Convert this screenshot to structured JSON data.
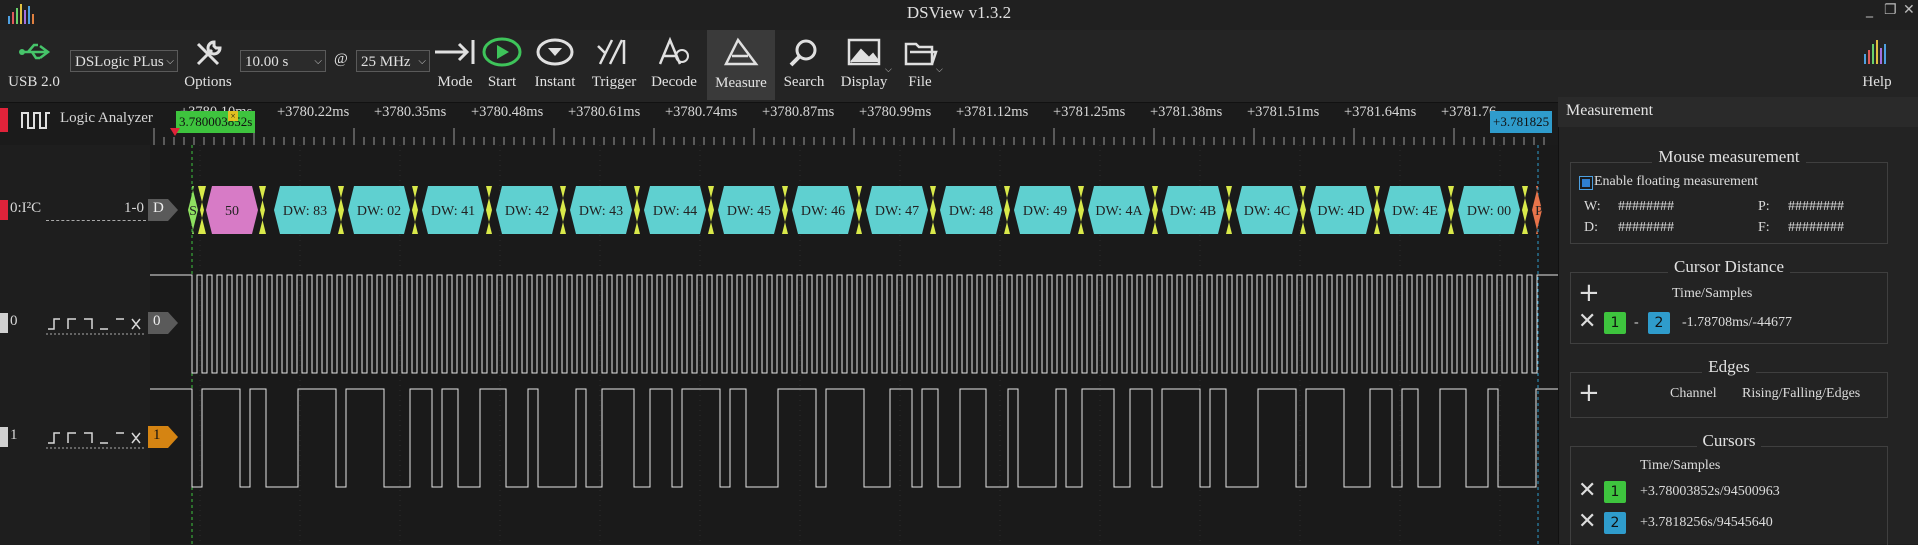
{
  "window": {
    "title": "DSView v1.3.2"
  },
  "toolbar": {
    "usb_label": "USB 2.0",
    "device": "DSLogic PLus",
    "options_label": "Options",
    "duration": "10.00 s",
    "at": "@",
    "rate": "25 MHz",
    "buttons": [
      "Mode",
      "Start",
      "Instant",
      "Trigger",
      "Decode",
      "Measure",
      "Search",
      "Display",
      "File"
    ],
    "help_label": "Help"
  },
  "ruler": {
    "ticks": [
      "+3780.10ms",
      "+3780.22ms",
      "+3780.35ms",
      "+3780.48ms",
      "+3780.61ms",
      "+3780.74ms",
      "+3780.87ms",
      "+3780.99ms",
      "+3781.12ms",
      "+3781.25ms",
      "+3781.38ms",
      "+3781.51ms",
      "+3781.64ms",
      "+3781.76"
    ],
    "cursor1_flag": "3.780003852s",
    "cursor2_flag": "+3.781825"
  },
  "channels": {
    "analyzer": "Logic Analyzer",
    "i2c_name": "0:I²C",
    "i2c_range": "1-0",
    "i2c_tag": "D",
    "ch0_num": "0",
    "ch0_tag": "0",
    "ch1_num": "1",
    "ch1_tag": "1"
  },
  "decode": {
    "start": "S",
    "addr": "50",
    "bytes": [
      "DW: 83",
      "DW: 02",
      "DW: 41",
      "DW: 42",
      "DW: 43",
      "DW: 44",
      "DW: 45",
      "DW: 46",
      "DW: 47",
      "DW: 48",
      "DW: 49",
      "DW: 4A",
      "DW: 4B",
      "DW: 4C",
      "DW: 4D",
      "DW: 4E",
      "DW: 00"
    ],
    "stop": "P",
    "colors": {
      "data": "#5fd0d0",
      "addr": "#d77bc6",
      "start": "#8ee060",
      "ack": "#d9e94a",
      "stop": "#e8744a"
    }
  },
  "panel": {
    "title": "Measurement",
    "mouse": {
      "title": "Mouse measurement",
      "enable": "Enable floating measurement",
      "w_label": "W:",
      "w_val": "########",
      "p_label": "P:",
      "p_val": "########",
      "d_label": "D:",
      "d_val": "########",
      "f_label": "F:",
      "f_val": "########"
    },
    "cursor_distance": {
      "title": "Cursor Distance",
      "header": "Time/Samples",
      "c1": "1",
      "dash": "-",
      "c2": "2",
      "value": "-1.78708ms/-44677"
    },
    "edges": {
      "title": "Edges",
      "col1": "Channel",
      "col2": "Rising/Falling/Edges"
    },
    "cursors": {
      "title": "Cursors",
      "header": "Time/Samples",
      "c1": "1",
      "c1_value": "+3.78003852s/94500963",
      "c2": "2",
      "c2_value": "+3.7818256s/94545640"
    }
  }
}
